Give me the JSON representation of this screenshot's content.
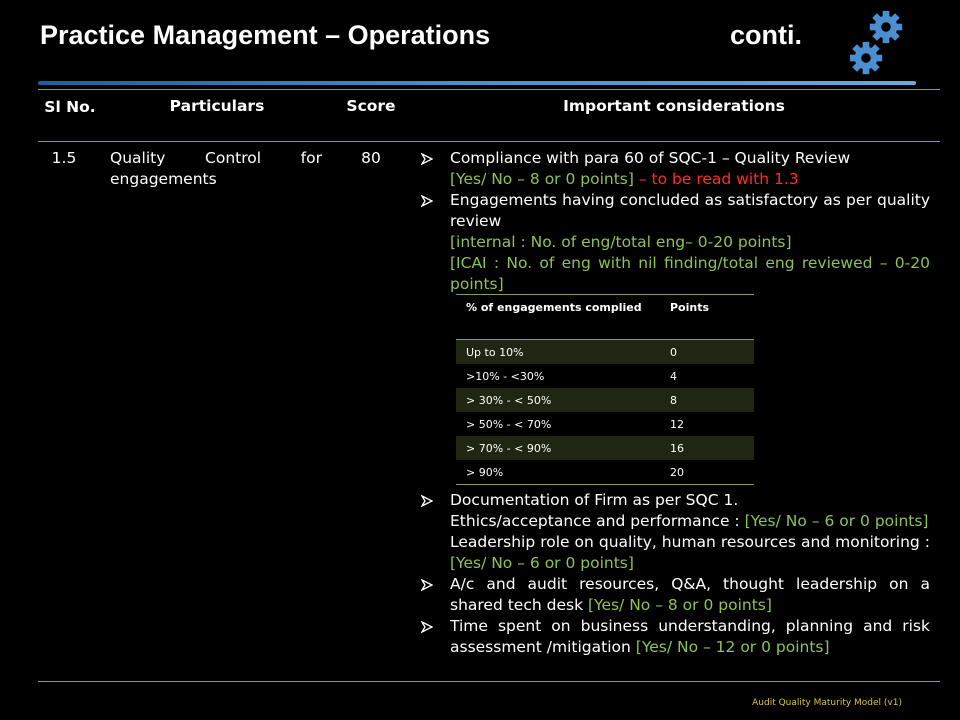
{
  "slide": {
    "title": "Practice Management – Operations",
    "title_suffix": "conti.",
    "footer": "Audit Quality Maturity Model (v1)"
  },
  "table": {
    "headers": {
      "sl": "Sl No.",
      "particulars": "Particulars",
      "score": "Score",
      "considerations": "Important considerations"
    },
    "row": {
      "sl": "1.5",
      "particulars_line1": "Quality Control for",
      "particulars_line2": "engagements",
      "score": "80"
    }
  },
  "considerations": {
    "c1_text": "Compliance with para 60 of SQC-1 – Quality Review",
    "c1_points": "[Yes/ No – 8 or 0 points]",
    "c1_dash": " – ",
    "c1_note": "to be read with 1.3",
    "c2_text": "Engagements having concluded as satisfactory as per quality review",
    "c2_internal": "[internal : No. of eng/total eng– 0-20 points]",
    "c2_icai": "[ICAI  : No. of eng with nil finding/total eng reviewed – 0-20 points]",
    "c3_text": "Documentation of Firm as per SQC 1.",
    "c3_ethics": "Ethics/acceptance and performance : ",
    "c3_ethics_points": "[Yes/ No – 6 or 0 points]",
    "c3_leadership": "Leadership role on quality, human resources and monitoring : ",
    "c3_leadership_points": "[Yes/ No – 6 or 0 points]",
    "c4_text": "A/c and audit resources, Q&A, thought leadership on a shared tech desk ",
    "c4_points": "[Yes/ No – 8 or 0 points]",
    "c5_text": "Time spent on business understanding, planning and risk assessment /mitigation ",
    "c5_points": "[Yes/ No – 12 or 0 points]"
  },
  "points_table": {
    "header_range": "% of engagements complied",
    "header_points": "Points",
    "rows": [
      {
        "range": "Up to 10%",
        "points": "0"
      },
      {
        "range": ">10% - <30%",
        "points": "4"
      },
      {
        "range": "> 30% - < 50%",
        "points": "8"
      },
      {
        "range": "> 50% - < 70%",
        "points": "12"
      },
      {
        "range": "> 70% - < 90%",
        "points": "16"
      },
      {
        "range": "> 90%",
        "points": "20"
      }
    ]
  },
  "colors": {
    "accent_blue": "#4a90d0",
    "points_green": "#8fc157",
    "note_red": "#ff2b2b",
    "rule_olive": "#8a9a5b",
    "footer_gold": "#d8c24a"
  },
  "icons": {
    "gears": "gears-icon",
    "bullet": "arrow-bullet-icon"
  }
}
